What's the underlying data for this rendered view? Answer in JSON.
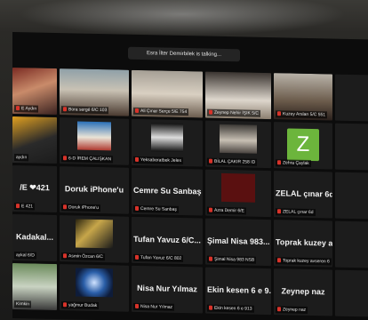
{
  "meeting": {
    "talking_banner": "Esra İlter Demirbilek is talking..."
  },
  "tiles": [
    {
      "label": "E Aydın",
      "name": ""
    },
    {
      "label": "Bora sergé 6/C 103",
      "name": ""
    },
    {
      "label": "Ali Çınar Serçe 5/E 754",
      "name": ""
    },
    {
      "label": "Zeynep Nehir İŞIK 5/C",
      "name": ""
    },
    {
      "label": "Kuzey Arslan 5/C 551",
      "name": ""
    },
    {
      "label": "",
      "name": ""
    },
    {
      "label": "aydın",
      "name": ""
    },
    {
      "label": "6-D İREM ÇALIŞKAN",
      "name": ""
    },
    {
      "label": "Yeksaberatbek Jeles",
      "name": ""
    },
    {
      "label": "BİLAL ÇAKIR 258 ID",
      "name": ""
    },
    {
      "label": "Zehra Çaylak",
      "name": "Z"
    },
    {
      "label": "",
      "name": ""
    },
    {
      "label": "E 421",
      "name": "/E ❤421"
    },
    {
      "label": "Doruk iPhone'u",
      "name": "Doruk iPhone'u"
    },
    {
      "label": "Cemre Su Sanbaş",
      "name": "Cemre Su Sanbaş"
    },
    {
      "label": "Azra Demir 6/E",
      "name": ""
    },
    {
      "label": "ZELAL çınar 6d",
      "name": "ZELAL çınar 6d"
    },
    {
      "label": "",
      "name": ""
    },
    {
      "label": "aykal 6/D",
      "name": "Kadakal..."
    },
    {
      "label": "Asmin Özcan 6/C",
      "name": ""
    },
    {
      "label": "Tufan Yavuz 6/C 802",
      "name": "Tufan Yavuz 6/C..."
    },
    {
      "label": "Şimal Nisa 983 NSB",
      "name": "Şimal Nisa 983..."
    },
    {
      "label": "Toprak kuzey avseren 6",
      "name": "Toprak kuzey a..."
    },
    {
      "label": "",
      "name": ""
    },
    {
      "label": "Kimkin",
      "name": ""
    },
    {
      "label": "yağmur Budak",
      "name": ""
    },
    {
      "label": "Nisa Nur Yılmaz",
      "name": "Nisa Nur Yılmaz"
    },
    {
      "label": "Ekin kesen 6 e 913",
      "name": "Ekin kesen 6 e 9..."
    },
    {
      "label": "Zeynep naz",
      "name": "Zeynep naz"
    },
    {
      "label": "",
      "name": ""
    }
  ]
}
